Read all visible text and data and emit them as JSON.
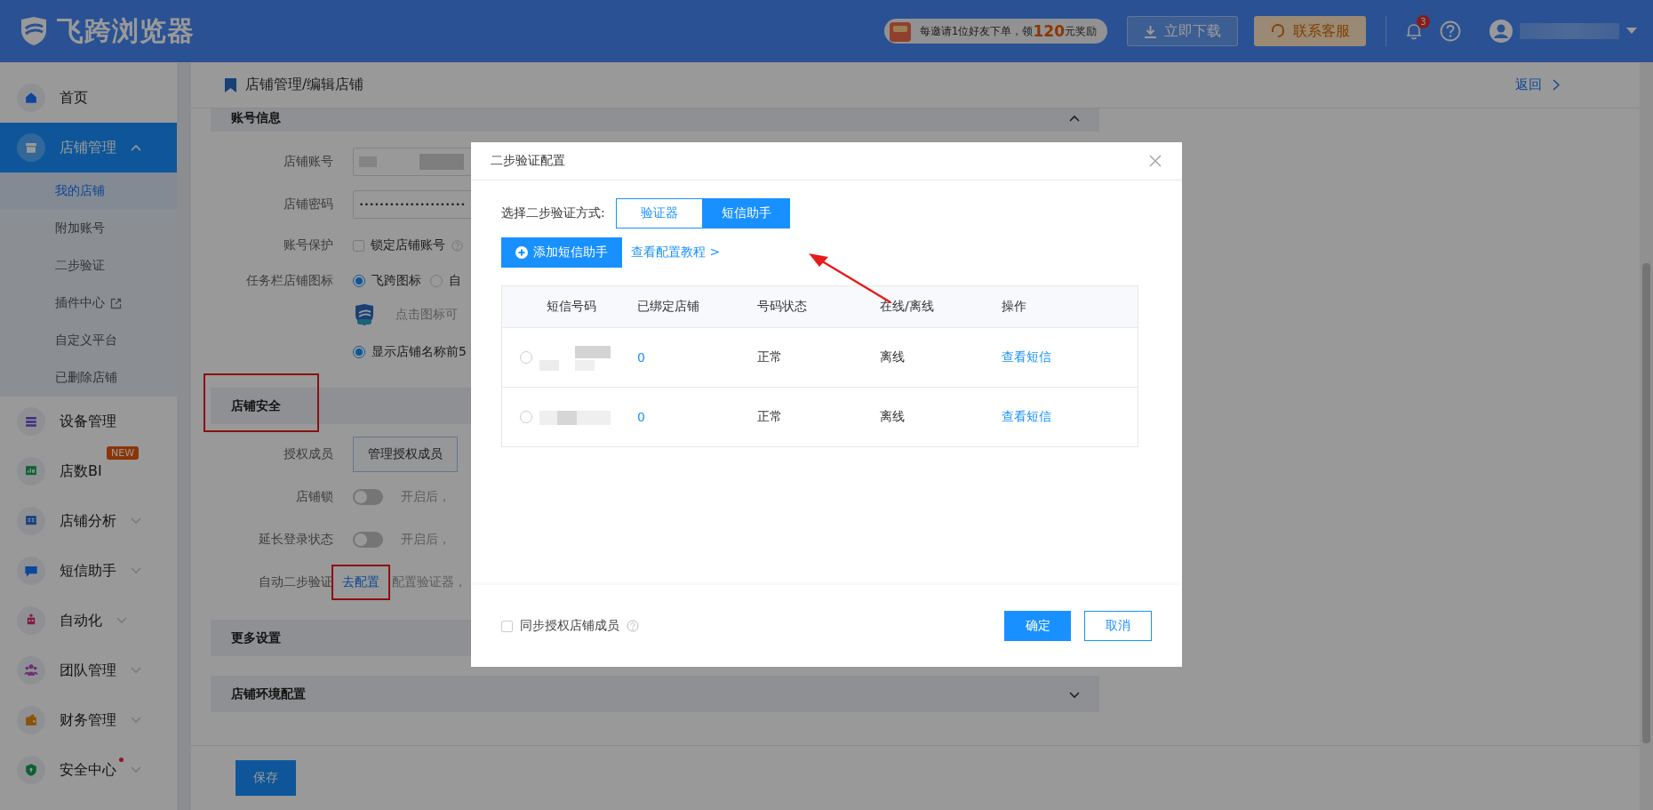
{
  "header": {
    "logo_text": "飞跨浏览器",
    "promo": {
      "text": "每邀请1位好友下单，领",
      "amount": "120",
      "suffix": "元奖励"
    },
    "download_button": "立即下载",
    "support_button": "联系客服",
    "notification_count": "3"
  },
  "sidebar": {
    "items": [
      {
        "label": "首页",
        "selected": false
      },
      {
        "label": "店铺管理",
        "selected": true,
        "expanded": true,
        "children": [
          {
            "label": "我的店铺",
            "selected": true
          },
          {
            "label": "附加账号",
            "selected": false
          },
          {
            "label": "二步验证",
            "selected": false
          },
          {
            "label": "插件中心",
            "selected": false,
            "external": true
          },
          {
            "label": "自定义平台",
            "selected": false
          },
          {
            "label": "已删除店铺",
            "selected": false
          }
        ]
      },
      {
        "label": "设备管理",
        "selected": false
      },
      {
        "label": "店数BI",
        "selected": false,
        "badge": "NEW"
      },
      {
        "label": "店铺分析",
        "selected": false,
        "expanded": false
      },
      {
        "label": "短信助手",
        "selected": false,
        "expanded": false
      },
      {
        "label": "自动化",
        "selected": false,
        "expanded": false
      },
      {
        "label": "团队管理",
        "selected": false,
        "expanded": false
      },
      {
        "label": "财务管理",
        "selected": false,
        "expanded": false
      },
      {
        "label": "安全中心",
        "selected": false,
        "expanded": false,
        "dot": true
      }
    ]
  },
  "breadcrumb": "店铺管理/编辑店铺",
  "back_link": "返回",
  "form": {
    "sections": [
      {
        "title": "账号信息",
        "expanded": true,
        "annotated": false,
        "rows": [
          {
            "kind": "text-input",
            "label": "店铺账号"
          },
          {
            "kind": "password",
            "label": "店铺密码",
            "value": "•••••••••••••••••••••"
          },
          {
            "kind": "checkbox",
            "label": "账号保护",
            "text": "锁定店铺账号",
            "checked": false,
            "help": true
          },
          {
            "kind": "radio",
            "label": "任务栏店铺图标",
            "options": [
              {
                "text": "飞跨图标",
                "selected": true
              },
              {
                "text": "自",
                "selected": false
              }
            ]
          },
          {
            "kind": "icon-note",
            "text": "点击图标可"
          },
          {
            "kind": "check-radio",
            "text": "显示店铺名称前5",
            "checked": true
          }
        ]
      },
      {
        "title": "店铺安全",
        "annotated": true,
        "rows": [
          {
            "kind": "button",
            "label": "授权成员",
            "text": "管理授权成员"
          },
          {
            "kind": "toggle",
            "label": "店铺锁",
            "on": false,
            "note": "开启后，"
          },
          {
            "kind": "toggle",
            "label": "延长登录状态",
            "on": false,
            "note": "开启后，"
          },
          {
            "kind": "link",
            "label": "自动二步验证",
            "text": "去配置",
            "annotated": true,
            "note": "配置验证器，"
          }
        ]
      },
      {
        "title": "更多设置",
        "annotated": false
      },
      {
        "title": "店铺环境配置",
        "expanded": false,
        "annotated": false
      }
    ]
  },
  "save_button": "保存",
  "dialog": {
    "title": "二步验证配置",
    "method_label": "选择二步验证方式:",
    "methods": [
      {
        "label": "验证器",
        "selected": false
      },
      {
        "label": "短信助手",
        "selected": true
      }
    ],
    "add_button": "添加短信助手",
    "tutorial_link": "查看配置教程 >",
    "table": {
      "columns": [
        "短信号码",
        "已绑定店铺",
        "号码状态",
        "在线/离线",
        "操作"
      ],
      "rows": [
        {
          "selected": false,
          "bound_stores": "0",
          "status": "正常",
          "online": "离线",
          "action": "查看短信"
        },
        {
          "selected": false,
          "bound_stores": "0",
          "status": "正常",
          "online": "离线",
          "action": "查看短信"
        }
      ]
    },
    "sync_members": {
      "label": "同步授权店铺成员",
      "checked": false
    },
    "confirm_button": "确定",
    "cancel_button": "取消"
  }
}
